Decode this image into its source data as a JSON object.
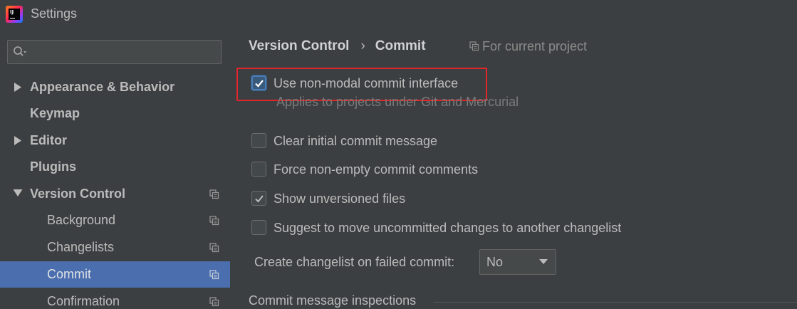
{
  "window": {
    "title": "Settings",
    "app_icon_letters": "IJ"
  },
  "sidebar": {
    "search": {
      "value": "",
      "placeholder": ""
    },
    "items": [
      {
        "label": "Appearance & Behavior",
        "expandable": true,
        "expanded": false,
        "bold": true,
        "level": 0,
        "project_icon": false
      },
      {
        "label": "Keymap",
        "expandable": false,
        "bold": true,
        "level": 0,
        "project_icon": false
      },
      {
        "label": "Editor",
        "expandable": true,
        "expanded": false,
        "bold": true,
        "level": 0,
        "project_icon": false
      },
      {
        "label": "Plugins",
        "expandable": false,
        "bold": true,
        "level": 0,
        "project_icon": false
      },
      {
        "label": "Version Control",
        "expandable": true,
        "expanded": true,
        "bold": true,
        "level": 0,
        "project_icon": true
      },
      {
        "label": "Background",
        "expandable": false,
        "bold": false,
        "level": 1,
        "project_icon": true
      },
      {
        "label": "Changelists",
        "expandable": false,
        "bold": false,
        "level": 1,
        "project_icon": true
      },
      {
        "label": "Commit",
        "expandable": false,
        "bold": false,
        "level": 1,
        "project_icon": true,
        "selected": true
      },
      {
        "label": "Confirmation",
        "expandable": false,
        "bold": false,
        "level": 1,
        "project_icon": true
      }
    ]
  },
  "main": {
    "breadcrumb": {
      "parent": "Version Control",
      "separator": "›",
      "current": "Commit"
    },
    "scope_label": "For current project",
    "options": [
      {
        "label": "Use non-modal commit interface",
        "checked": true,
        "focused": true,
        "highlighted": true
      },
      {
        "label": "Clear initial commit message",
        "checked": false
      },
      {
        "label": "Force non-empty commit comments",
        "checked": false
      },
      {
        "label": "Show unversioned files",
        "checked": true
      },
      {
        "label": "Suggest to move uncommitted changes to another changelist",
        "checked": false
      }
    ],
    "hint": "Applies to projects under Git and Mercurial",
    "changelist_on_failure": {
      "label": "Create changelist on failed commit:",
      "selected": "No"
    },
    "section_title": "Commit message inspections"
  },
  "colors": {
    "background": "#3c3f41",
    "selection": "#4b6eaf",
    "highlight_border": "#e0262b",
    "text": "#bbbbbb",
    "hint_text": "#7a7a7a"
  }
}
